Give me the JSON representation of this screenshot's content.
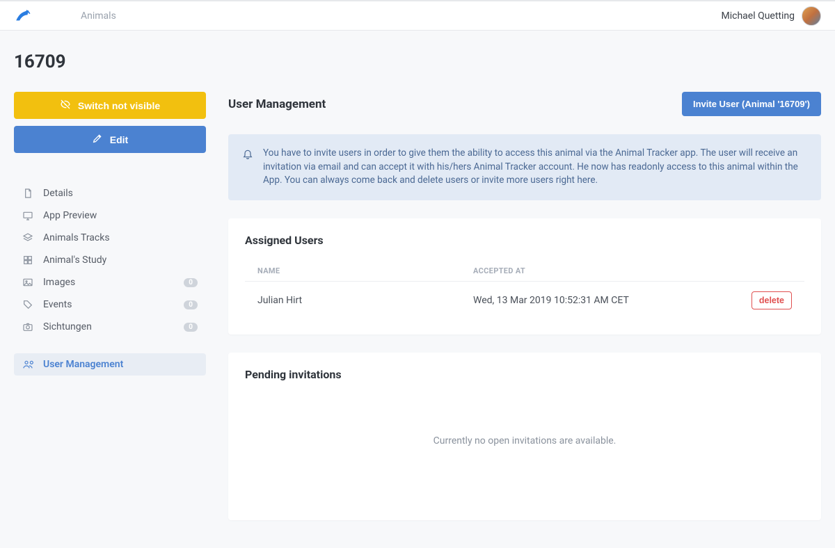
{
  "header": {
    "breadcrumb": "Animals",
    "user_name": "Michael Quetting"
  },
  "page": {
    "title": "16709"
  },
  "sidebar": {
    "switch_btn": "Switch not visible",
    "edit_btn": "Edit",
    "items": [
      {
        "label": "Details"
      },
      {
        "label": "App Preview"
      },
      {
        "label": "Animals Tracks"
      },
      {
        "label": "Animal's Study"
      },
      {
        "label": "Images",
        "badge": "0"
      },
      {
        "label": "Events",
        "badge": "0"
      },
      {
        "label": "Sichtungen",
        "badge": "0"
      },
      {
        "label": "User Management"
      }
    ]
  },
  "main": {
    "title": "User Management",
    "invite_btn": "Invite User (Animal '16709')",
    "banner": "You have to invite users in order to give them the ability to access this animal via the Animal Tracker app. The user will receive an invitation via email and can accept it with his/hers Animal Tracker account. He now has readonly access to this animal within the App. You can always come back and delete users or invite more users right here.",
    "assigned": {
      "title": "Assigned Users",
      "col_name": "NAME",
      "col_accepted": "ACCEPTED AT",
      "rows": [
        {
          "name": "Julian Hirt",
          "accepted": "Wed, 13 Mar 2019 10:52:31 AM CET",
          "delete": "delete"
        }
      ]
    },
    "pending": {
      "title": "Pending invitations",
      "empty": "Currently no open invitations are available."
    }
  }
}
